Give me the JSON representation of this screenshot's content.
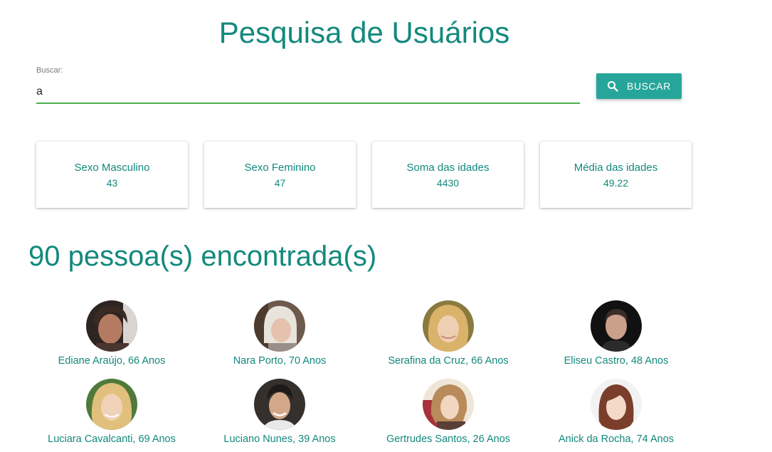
{
  "header": {
    "title": "Pesquisa de Usuários"
  },
  "search": {
    "label": "Buscar:",
    "value": "a",
    "button_icon": "search-icon",
    "button_label": "BUSCAR"
  },
  "stats": [
    {
      "label": "Sexo Masculino",
      "value": "43"
    },
    {
      "label": "Sexo Feminino",
      "value": "47"
    },
    {
      "label": "Soma das idades",
      "value": "4430"
    },
    {
      "label": "Média das idades",
      "value": "49.22"
    }
  ],
  "results": {
    "count_text": "90 pessoa(s) encontrada(s)"
  },
  "people": [
    {
      "caption": "Ediane Araújo, 66 Anos"
    },
    {
      "caption": "Nara Porto, 70 Anos"
    },
    {
      "caption": "Serafina da Cruz, 66 Anos"
    },
    {
      "caption": "Eliseu Castro, 48 Anos"
    },
    {
      "caption": "Luciara Cavalcanti, 69 Anos"
    },
    {
      "caption": "Luciano Nunes, 39 Anos"
    },
    {
      "caption": "Gertrudes Santos, 26 Anos"
    },
    {
      "caption": "Anick da Rocha, 74 Anos"
    }
  ],
  "colors": {
    "accent": "#12897c",
    "button": "#26a69a",
    "input_underline": "#4caf50"
  }
}
